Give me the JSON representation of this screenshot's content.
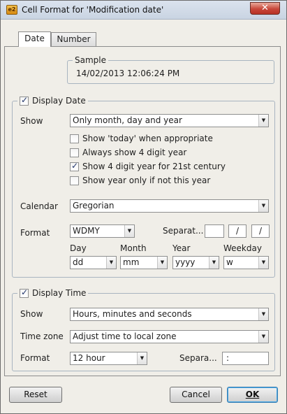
{
  "window": {
    "title": "Cell Format for 'Modification date'",
    "app_icon": "e2",
    "close_glyph": "✕"
  },
  "tabs": [
    {
      "label": "Date",
      "active": true
    },
    {
      "label": "Number",
      "active": false
    }
  ],
  "sample": {
    "legend": "Sample",
    "value": "14/02/2013 12:06:24 PM"
  },
  "display_date": {
    "label": "Display Date",
    "checked": true,
    "show_label": "Show",
    "show_value": "Only month, day and year",
    "options": [
      {
        "label": "Show 'today' when appropriate",
        "checked": false
      },
      {
        "label": "Always show 4 digit year",
        "checked": false
      },
      {
        "label": "Show 4 digit year for 21st century",
        "checked": true
      },
      {
        "label": "Show year only if not this year",
        "checked": false
      }
    ],
    "calendar_label": "Calendar",
    "calendar_value": "Gregorian",
    "format_label": "Format",
    "format_value": "WDMY",
    "separator_label": "Separat...",
    "separators": [
      "",
      "/",
      "/"
    ],
    "parts": [
      {
        "label": "Day",
        "value": "dd"
      },
      {
        "label": "Month",
        "value": "mm"
      },
      {
        "label": "Year",
        "value": "yyyy"
      },
      {
        "label": "Weekday",
        "value": "w"
      }
    ]
  },
  "display_time": {
    "label": "Display Time",
    "checked": true,
    "show_label": "Show",
    "show_value": "Hours, minutes and seconds",
    "timezone_label": "Time zone",
    "timezone_value": "Adjust time to local zone",
    "format_label": "Format",
    "format_value": "12 hour",
    "separator_label": "Separa...",
    "separator_value": ":"
  },
  "buttons": {
    "reset": "Reset",
    "cancel": "Cancel",
    "ok": "OK"
  },
  "icons": {
    "dropdown": "▼",
    "check": "✓"
  }
}
